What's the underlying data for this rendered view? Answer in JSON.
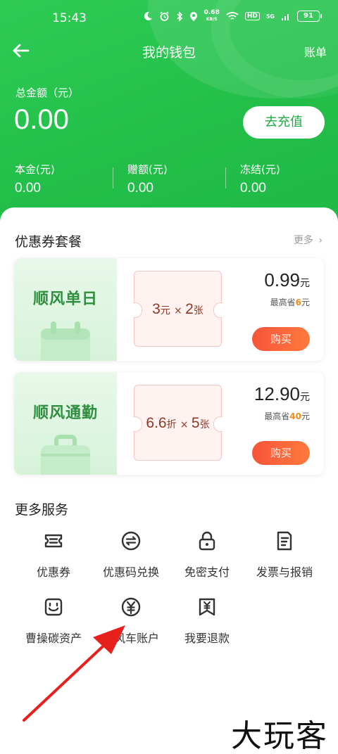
{
  "status_bar": {
    "time": "15:43",
    "net_speed_value": "0.68",
    "net_speed_unit": "KB/S",
    "hd": "HD",
    "signal": "5G",
    "battery": "91"
  },
  "navbar": {
    "title": "我的钱包",
    "right_link": "账单"
  },
  "balance": {
    "total_label": "总金额（元）",
    "total_value": "0.00",
    "recharge_button": "去充值",
    "items": [
      {
        "label": "本金(元)",
        "value": "0.00"
      },
      {
        "label": "赠额(元)",
        "value": "0.00"
      },
      {
        "label": "冻结(元)",
        "value": "0.00"
      }
    ]
  },
  "coupons": {
    "title": "优惠券套餐",
    "more": "更多",
    "packages": [
      {
        "name": "顺风单日",
        "ticket_amount": "3",
        "ticket_amount_unit": "元",
        "ticket_count": "2",
        "ticket_count_unit": "张",
        "price": "0.99",
        "price_unit": "元",
        "save_prefix": "最高省",
        "save_amount": "6",
        "save_unit": "元",
        "buy_button": "购买"
      },
      {
        "name": "顺风通勤",
        "ticket_amount": "6.6",
        "ticket_amount_unit": "折",
        "ticket_count": "5",
        "ticket_count_unit": "张",
        "price": "12.90",
        "price_unit": "元",
        "save_prefix": "最高省",
        "save_amount": "40",
        "save_unit": "元",
        "buy_button": "购买"
      }
    ]
  },
  "services": {
    "title": "更多服务",
    "items": [
      {
        "label": "优惠券",
        "icon": "coupon-icon"
      },
      {
        "label": "优惠码兑换",
        "icon": "exchange-icon"
      },
      {
        "label": "免密支付",
        "icon": "lock-icon"
      },
      {
        "label": "发票与报销",
        "icon": "invoice-icon"
      },
      {
        "label": "曹操碳资产",
        "icon": "carbon-icon"
      },
      {
        "label": "顺风车账户",
        "icon": "yuan-icon"
      },
      {
        "label": "我要退款",
        "icon": "refund-icon"
      }
    ]
  },
  "watermark": "大玩客",
  "colors": {
    "brand_green": "#22bf49",
    "buy_red": "#f8543a",
    "ticket_text": "#8b3a26",
    "save_orange": "#f08a1a",
    "arrow_red": "#e8201c"
  }
}
